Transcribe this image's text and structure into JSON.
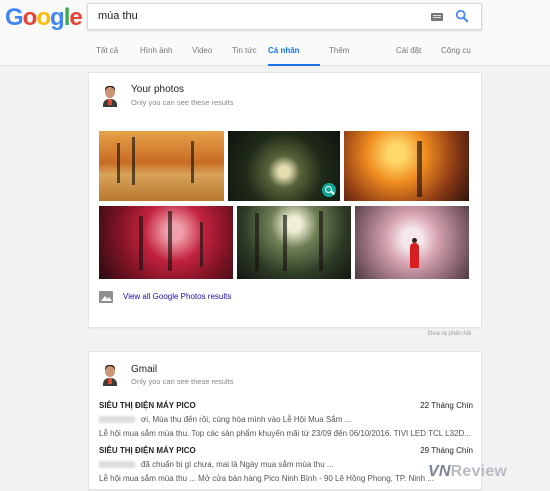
{
  "app": {
    "logo": [
      "G",
      "o",
      "o",
      "g",
      "l",
      "e"
    ],
    "logo_colors": [
      "#4285F4",
      "#EA4335",
      "#FBBC05",
      "#4285F4",
      "#34A853",
      "#EA4335"
    ]
  },
  "search": {
    "query": "múa thu",
    "keyboard_icon": "keyboard-icon",
    "search_icon": "search-icon"
  },
  "tabs": [
    {
      "label": "Tất cả",
      "active": false
    },
    {
      "label": "Hình ảnh",
      "active": false
    },
    {
      "label": "Video",
      "active": false
    },
    {
      "label": "Tin tức",
      "active": false
    },
    {
      "label": "Cá nhân",
      "active": true
    },
    {
      "label": "Thêm",
      "active": false
    },
    {
      "label": "Cài đặt",
      "active": false
    },
    {
      "label": "Công cụ",
      "active": false
    }
  ],
  "photos_card": {
    "title": "Your photos",
    "subtitle": "Only you can see these results",
    "link": "View all Google Photos results",
    "images": [
      "autumn-path-photo",
      "forest-tunnel-photo",
      "sunlit-tree-photo",
      "red-forest-photo",
      "woodland-light-photo",
      "pink-blossom-photo"
    ]
  },
  "feedback": {
    "label": "Đưa ra phản hồi"
  },
  "gmail_card": {
    "title": "Gmail",
    "subtitle": "Only you can see these results",
    "messages": [
      {
        "sender": "SIÊU THỊ ĐIỆN MÁY PICO",
        "date": "22 Tháng Chín",
        "snippet": "ơi, Mùa thu đến rồi, cùng hòa mình vào Lễ Hội Mua Sắm ...",
        "extra": "Lễ hội mua sắm mùa thu. Top các sản phẩm khuyến mãi từ 23/09 đến 06/10/2016. TIVI LED TCL L32D..."
      },
      {
        "sender": "SIÊU THỊ ĐIỆN MÁY PICO",
        "date": "29 Tháng Chín",
        "snippet": "đã chuẩn bị gì chưa, mai là Ngày mua sắm mùa thu ...",
        "extra": "Lễ hội mua sắm mùa thu ... Mở cửa bán hàng Pico Ninh Bình - 90 Lê Hồng Phong, TP. Ninh ..."
      }
    ]
  },
  "watermark": {
    "brand": "VN",
    "text": "Review"
  }
}
